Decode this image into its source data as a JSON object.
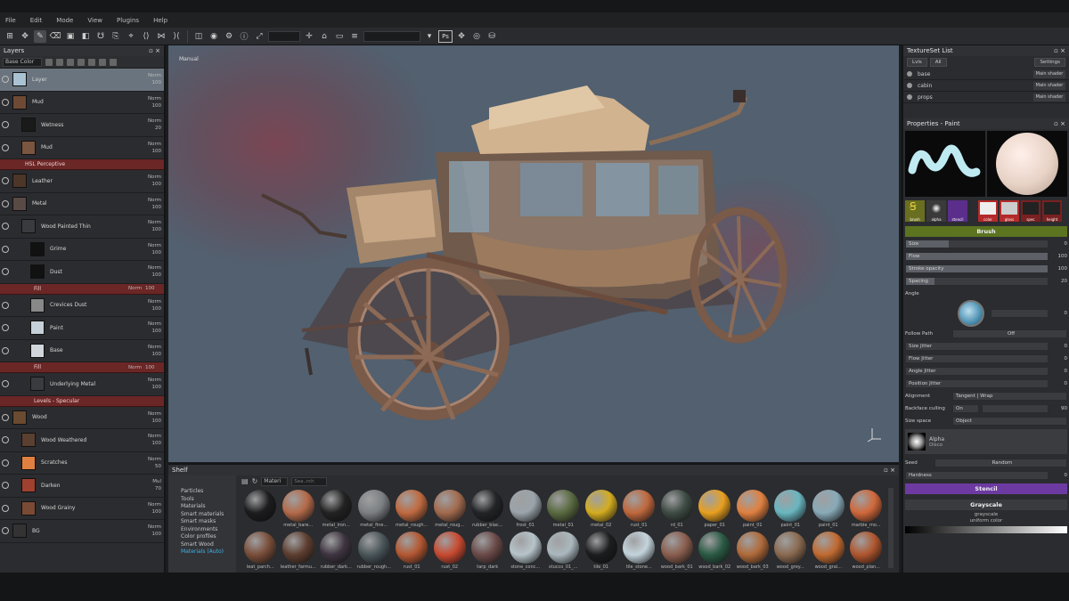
{
  "menu": [
    "File",
    "Edit",
    "Mode",
    "View",
    "Plugins",
    "Help"
  ],
  "toolbar": {
    "ps_label": "Ps"
  },
  "layers": {
    "title": "Layers",
    "blend_select": "Base Color",
    "rows": [
      {
        "name": "Layer",
        "meta1": "Norm",
        "meta2": "100",
        "type": "layer",
        "indent": 0,
        "thumb": "#a9c3d3",
        "selected": true
      },
      {
        "name": "Mud",
        "meta1": "Norm",
        "meta2": "100",
        "type": "layer",
        "indent": 0,
        "thumb": "#6e4a35"
      },
      {
        "name": "Wetness",
        "meta1": "Norm",
        "meta2": "20",
        "type": "layer",
        "indent": 1,
        "thumb": "#1a1a1a"
      },
      {
        "name": "Mud",
        "meta1": "Norm",
        "meta2": "100",
        "type": "layer",
        "indent": 1,
        "thumb": "#7a5540"
      },
      {
        "name": "HSL Perceptive",
        "meta1": "",
        "meta2": "",
        "type": "sub",
        "indent": 1
      },
      {
        "name": "Leather",
        "meta1": "Norm",
        "meta2": "100",
        "type": "layer",
        "indent": 0,
        "thumb": "#4d3528"
      },
      {
        "name": "Metal",
        "meta1": "Norm",
        "meta2": "100",
        "type": "layer",
        "indent": 0,
        "thumb": "#5a4a45"
      },
      {
        "name": "Wood Painted Thin",
        "meta1": "Norm",
        "meta2": "100",
        "type": "layer",
        "indent": 1,
        "thumb": ""
      },
      {
        "name": "Grime",
        "meta1": "Norm",
        "meta2": "100",
        "type": "layer",
        "indent": 2,
        "thumb": "#111"
      },
      {
        "name": "Dust",
        "meta1": "Norm",
        "meta2": "100",
        "type": "layer",
        "indent": 2,
        "thumb": "#111"
      },
      {
        "name": "Fill",
        "meta1": "Norm",
        "meta2": "100",
        "type": "sub",
        "indent": 2
      },
      {
        "name": "Crevices Dust",
        "meta1": "Norm",
        "meta2": "100",
        "type": "layer",
        "indent": 2,
        "thumb": "#888"
      },
      {
        "name": "Paint",
        "meta1": "Norm",
        "meta2": "100",
        "type": "layer",
        "indent": 2,
        "thumb": "#c5d0d8"
      },
      {
        "name": "Base",
        "meta1": "Norm",
        "meta2": "100",
        "type": "layer",
        "indent": 2,
        "thumb": "#d0d6db"
      },
      {
        "name": "Fill",
        "meta1": "Norm",
        "meta2": "100",
        "type": "sub",
        "indent": 2
      },
      {
        "name": "Underlying Metal",
        "meta1": "Norm",
        "meta2": "100",
        "type": "layer",
        "indent": 2,
        "thumb": ""
      },
      {
        "name": "Levels - Specular",
        "meta1": "",
        "meta2": "",
        "type": "sub",
        "indent": 2
      },
      {
        "name": "Wood",
        "meta1": "Norm",
        "meta2": "100",
        "type": "layer",
        "indent": 0,
        "thumb": "#6a4a30"
      },
      {
        "name": "Wood Weathered",
        "meta1": "Norm",
        "meta2": "100",
        "type": "layer",
        "indent": 1,
        "thumb": "#5a4030"
      },
      {
        "name": "Scratches",
        "meta1": "Norm",
        "meta2": "50",
        "type": "layer",
        "indent": 1,
        "thumb": "#e08040"
      },
      {
        "name": "Darken",
        "meta1": "Mul",
        "meta2": "70",
        "type": "layer",
        "indent": 1,
        "thumb": "#a04030"
      },
      {
        "name": "Wood Grainy",
        "meta1": "Norm",
        "meta2": "100",
        "type": "layer",
        "indent": 1,
        "thumb": "#7a4a35"
      },
      {
        "name": "BG",
        "meta1": "Norm",
        "meta2": "100",
        "type": "layer",
        "indent": 0,
        "thumb": "#333"
      }
    ]
  },
  "viewport": {
    "label": "Manual"
  },
  "shelf": {
    "title": "Shelf",
    "select": "Materi",
    "search_placeholder": "Sea..rch",
    "categories": [
      "Particles",
      "Tools",
      "Materials",
      "Smart materials",
      "Smart masks",
      "Environments",
      "Color profiles",
      "Smart Wood",
      "Materials (Auto)"
    ],
    "active_category": 8,
    "materials": [
      {
        "label": "",
        "color": "#1c1c1e"
      },
      {
        "label": "metal_bare...",
        "color": "#b46a4a"
      },
      {
        "label": "metal_iron...",
        "color": "#222"
      },
      {
        "label": "metal_fine...",
        "color": "#7c7f82"
      },
      {
        "label": "metal_rough...",
        "color": "#c06a40"
      },
      {
        "label": "metal_roug...",
        "color": "#a26a4e"
      },
      {
        "label": "rubber_blac...",
        "color": "#232427"
      },
      {
        "label": "frost_01",
        "color": "#9aa4aa"
      },
      {
        "label": "metal_01",
        "color": "#5a6a40"
      },
      {
        "label": "metal_02",
        "color": "#d3ac20"
      },
      {
        "label": "rust_01",
        "color": "#c0683c"
      },
      {
        "label": "rd_01",
        "color": "#3e4b44"
      },
      {
        "label": "paper_01",
        "color": "#e8a020"
      },
      {
        "label": "paint_01",
        "color": "#e08040"
      },
      {
        "label": "paint_01",
        "color": "#6ab6c0"
      },
      {
        "label": "paint_01",
        "color": "#88aab8"
      },
      {
        "label": "marble_mo...",
        "color": "#d0683a"
      },
      {
        "label": "leat_parch...",
        "color": "#7a4e3a"
      },
      {
        "label": "leather_farmu...",
        "color": "#5e3e30"
      },
      {
        "label": "rubber_dark...",
        "color": "#3e3440"
      },
      {
        "label": "rubber_rough...",
        "color": "#4a565a"
      },
      {
        "label": "rust_01",
        "color": "#b45832"
      },
      {
        "label": "rust_02",
        "color": "#c84a30"
      },
      {
        "label": "tarp_dark",
        "color": "#6a4a48"
      },
      {
        "label": "stone_conc...",
        "color": "#b6c4ca"
      },
      {
        "label": "stucco_01_...",
        "color": "#aab8be"
      },
      {
        "label": "tile_01",
        "color": "#1c1d1f"
      },
      {
        "label": "tile_stone...",
        "color": "#c4d4dc"
      },
      {
        "label": "wood_bark_01",
        "color": "#8a5e4e"
      },
      {
        "label": "wood_bark_02",
        "color": "#2a5a44"
      },
      {
        "label": "wood_bark_03",
        "color": "#b06a3a"
      },
      {
        "label": "wood_grey...",
        "color": "#8a6a50"
      },
      {
        "label": "wood_grai...",
        "color": "#c06a30"
      },
      {
        "label": "wood_plan...",
        "color": "#b0562e"
      }
    ]
  },
  "textureset": {
    "title": "TextureSet List",
    "tools": [
      "Lvls",
      "All",
      "Settings"
    ],
    "rows": [
      {
        "name": "base",
        "shader": "Main shader"
      },
      {
        "name": "cabin",
        "shader": "Main shader"
      },
      {
        "name": "props",
        "shader": "Main shader"
      }
    ]
  },
  "properties": {
    "title": "Properties - Paint",
    "swatches": [
      "brush",
      "alpha",
      "stencil",
      "color",
      "gloss",
      "spec",
      "height"
    ],
    "brush_header": "Brush",
    "rows": [
      {
        "label": "Size",
        "value": "0",
        "fill": 0.3
      },
      {
        "label": "Flow",
        "value": "100",
        "fill": 1
      },
      {
        "label": "Stroke opacity",
        "value": "100",
        "fill": 1
      },
      {
        "label": "Spacing",
        "value": "20",
        "fill": 0.2
      }
    ],
    "angle_label": "Angle",
    "angle_value": "0",
    "follow_path_label": "Follow Path",
    "follow_path_value": "Off",
    "jitter_rows": [
      {
        "label": "Size Jitter",
        "value": "0"
      },
      {
        "label": "Flow Jitter",
        "value": "0"
      },
      {
        "label": "Angle Jitter",
        "value": "0"
      },
      {
        "label": "Position Jitter",
        "value": "0"
      }
    ],
    "alignment_label": "Alignment",
    "alignment_value": "Tangent | Wrap",
    "backface_label": "Backface culling",
    "backface_value": "On",
    "backface_num": "90",
    "sizespace_label": "Size space",
    "sizespace_value": "Object",
    "alpha_label": "Alpha",
    "alpha_name": "Disco",
    "seed_label": "Seed",
    "seed_value": "Random",
    "hardness_label": "Hardness",
    "hardness_value": "0",
    "stencil_header": "Stencil",
    "grayscale_header": "Grayscale",
    "grayscale_line1": "grayscale",
    "grayscale_line2": "uniform color"
  }
}
